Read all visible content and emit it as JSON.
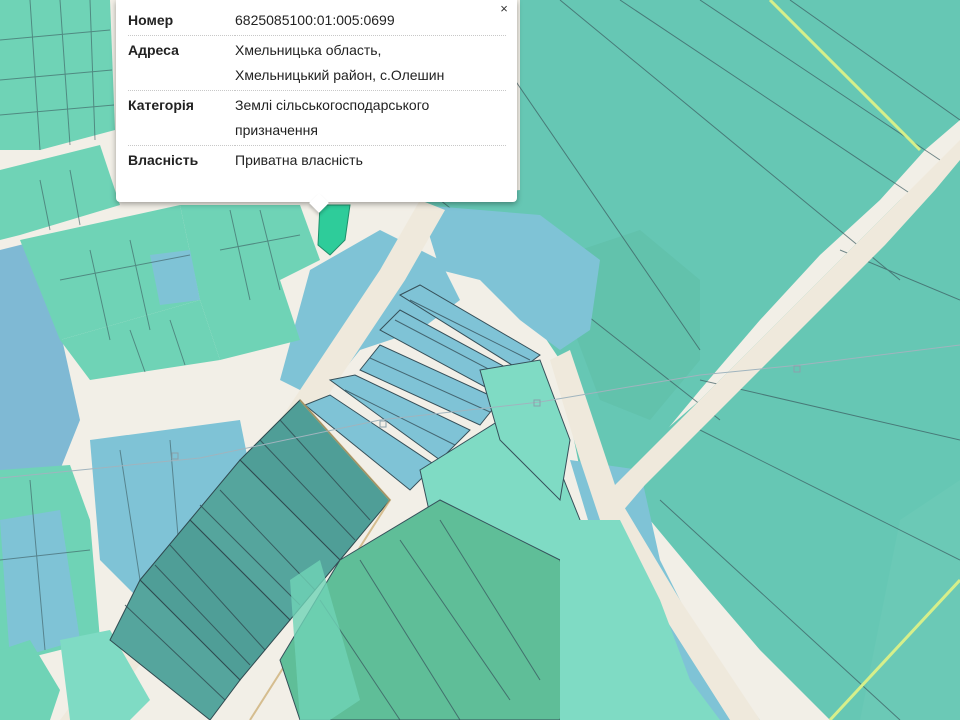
{
  "map": {
    "layer_colors": {
      "background": "#f2efe7",
      "road": "#efe9dc",
      "parcel_large": "#66c7b4",
      "parcel_light": "#7fdbc4",
      "parcel_blue": "#7fc3d6",
      "parcel_dark": "#4f9e97",
      "parcel_highlight": "#2ecc9a",
      "parcel_border": "#36505a",
      "utility_line": "#a0b4be"
    }
  },
  "popup": {
    "close_label": "×",
    "rows": [
      {
        "key": "Номер",
        "value_lines": [
          "6825085100:01:005:0699"
        ]
      },
      {
        "key": "Адреса",
        "value_lines": [
          "Хмельницька область,",
          "Хмельницький район, с.Олешин"
        ]
      },
      {
        "key": "Категорія",
        "value_lines": [
          "Землі сільськогосподарського",
          "призначення"
        ]
      },
      {
        "key": "Власність",
        "value_lines": [
          "Приватна власність"
        ]
      }
    ]
  }
}
